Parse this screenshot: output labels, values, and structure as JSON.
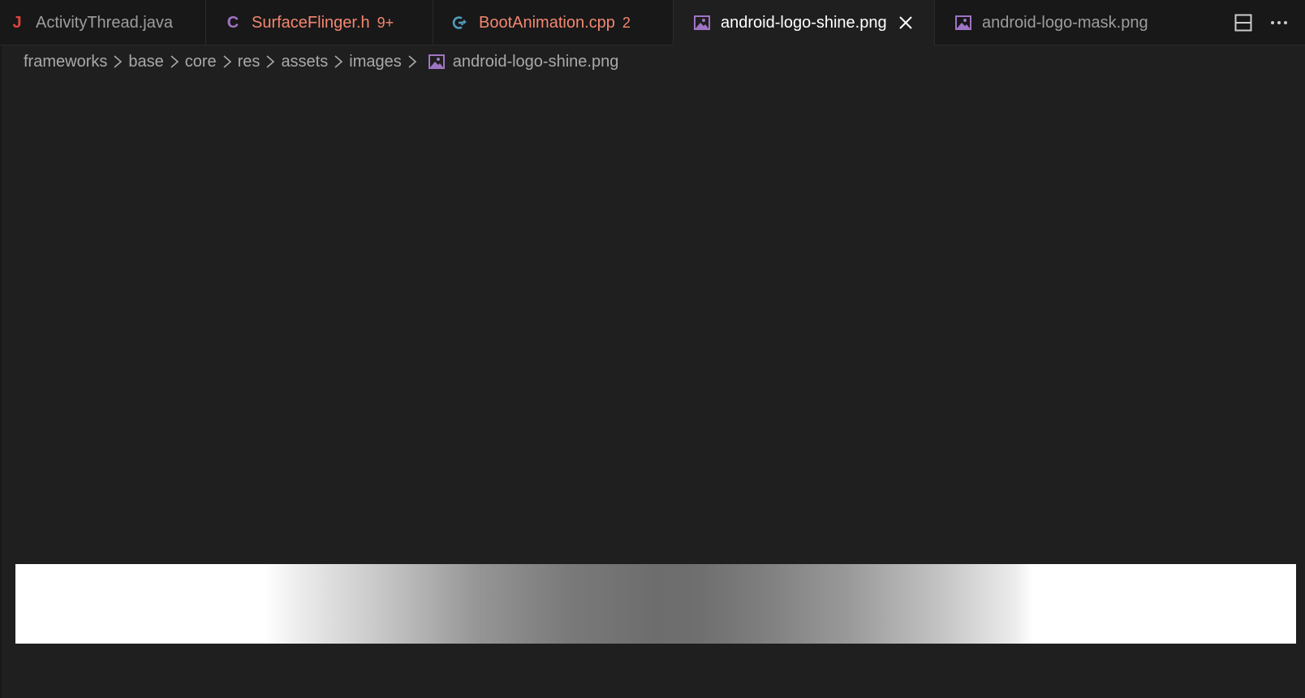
{
  "tabs": [
    {
      "label": "ActivityThread.java",
      "icon": "java-file-icon",
      "glyph": "J",
      "color": "#e0443e",
      "badge": "",
      "state": "normal"
    },
    {
      "label": "SurfaceFlinger.h",
      "icon": "c-header-file-icon",
      "glyph": "C",
      "color": "#a074c4",
      "badge": "9+",
      "state": "error"
    },
    {
      "label": "BootAnimation.cpp",
      "icon": "cpp-file-icon",
      "glyph": "G+",
      "color": "#519aba",
      "badge": "2",
      "state": "error"
    },
    {
      "label": "android-logo-shine.png",
      "icon": "image-file-icon",
      "glyph": "",
      "color": "#a074c4",
      "badge": "",
      "state": "active"
    },
    {
      "label": "android-logo-mask.png",
      "icon": "image-file-icon",
      "glyph": "",
      "color": "#a074c4",
      "badge": "",
      "state": "normal"
    }
  ],
  "actions": {
    "split": "split-editor-icon",
    "more": "more-actions-icon"
  },
  "breadcrumb": {
    "items": [
      "frameworks",
      "base",
      "core",
      "res",
      "assets",
      "images"
    ],
    "file": "android-logo-shine.png"
  },
  "colors": {
    "error_text": "#f48771",
    "active_text": "#ffffff",
    "inactive_text": "#9d9d9d",
    "editor_bg": "#1f1f1f",
    "tabbar_bg": "#181818"
  }
}
